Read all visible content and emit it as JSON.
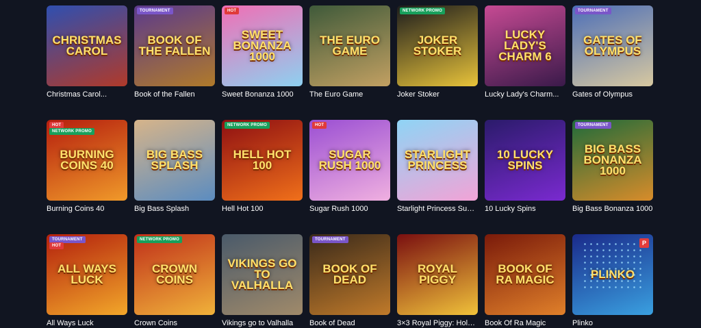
{
  "games": [
    {
      "name": "Christmas Carol...",
      "art_title": "Christmas Carol",
      "bg": [
        "#2f4fb0",
        "#b03a2a"
      ],
      "badges": []
    },
    {
      "name": "Book of the Fallen",
      "art_title": "Book of the Fallen",
      "bg": [
        "#5b3a8c",
        "#b07a2a"
      ],
      "badges": [
        {
          "text": "TOURNAMENT",
          "type": "tournament"
        }
      ]
    },
    {
      "name": "Sweet Bonanza 1000",
      "art_title": "Sweet Bonanza 1000",
      "bg": [
        "#f06fb5",
        "#8ed0f0"
      ],
      "badges": [
        {
          "text": "HOT",
          "type": "hot"
        }
      ]
    },
    {
      "name": "The Euro Game",
      "art_title": "The Euro Game",
      "bg": [
        "#3f5a3a",
        "#c2a062"
      ],
      "badges": []
    },
    {
      "name": "Joker Stoker",
      "art_title": "Joker Stoker",
      "bg": [
        "#1d1d1d",
        "#e8c33a"
      ],
      "badges": [
        {
          "text": "NETWORK PROMO",
          "type": "network"
        }
      ]
    },
    {
      "name": "Lucky Lady's Charm...",
      "art_title": "Lucky Lady's Charm 6",
      "bg": [
        "#c64a93",
        "#3a1a4a"
      ],
      "badges": []
    },
    {
      "name": "Gates of Olympus",
      "art_title": "Gates of Olympus",
      "bg": [
        "#4d6fb8",
        "#d7c8a0"
      ],
      "badges": [
        {
          "text": "TOURNAMENT",
          "type": "tournament"
        }
      ]
    },
    {
      "name": "Burning Coins 40",
      "art_title": "Burning Coins 40",
      "bg": [
        "#b51e0e",
        "#f09a2a"
      ],
      "badges": [
        {
          "text": "HOT",
          "type": "hot"
        },
        {
          "text": "NETWORK PROMO",
          "type": "network"
        }
      ]
    },
    {
      "name": "Big Bass Splash",
      "art_title": "Big Bass Splash",
      "bg": [
        "#d6b48a",
        "#5b8cc0"
      ],
      "badges": []
    },
    {
      "name": "Hell Hot 100",
      "art_title": "Hell Hot 100",
      "bg": [
        "#8e0f12",
        "#f0701a"
      ],
      "badges": [
        {
          "text": "NETWORK PROMO",
          "type": "network"
        }
      ]
    },
    {
      "name": "Sugar Rush 1000",
      "art_title": "Sugar Rush 1000",
      "bg": [
        "#9b4fd3",
        "#f0b0e0"
      ],
      "badges": [
        {
          "text": "HOT",
          "type": "hot"
        }
      ]
    },
    {
      "name": "Starlight Princess Supe...",
      "art_title": "Starlight Princess",
      "bg": [
        "#8fd4f5",
        "#f2a3d6"
      ],
      "badges": []
    },
    {
      "name": "10 Lucky Spins",
      "art_title": "10 Lucky Spins",
      "bg": [
        "#2b1b6b",
        "#7a2ad0"
      ],
      "badges": []
    },
    {
      "name": "Big Bass Bonanza 1000",
      "art_title": "Big Bass Bonanza 1000",
      "bg": [
        "#1f6b3a",
        "#d88c2a"
      ],
      "badges": [
        {
          "text": "TOURNAMENT",
          "type": "tournament"
        }
      ]
    },
    {
      "name": "All Ways Luck",
      "art_title": "All Ways Luck",
      "bg": [
        "#b3200d",
        "#f2a72a"
      ],
      "badges": [
        {
          "text": "TOURNAMENT",
          "type": "tournament"
        },
        {
          "text": "HOT",
          "type": "hot"
        }
      ]
    },
    {
      "name": "Crown Coins",
      "art_title": "Crown Coins",
      "bg": [
        "#c0301a",
        "#f0b23a"
      ],
      "badges": [
        {
          "text": "NETWORK PROMO",
          "type": "network"
        }
      ]
    },
    {
      "name": "Vikings go to Valhalla",
      "art_title": "Vikings go to Valhalla",
      "bg": [
        "#4a5a6a",
        "#a08a6a"
      ],
      "badges": []
    },
    {
      "name": "Book of Dead",
      "art_title": "Book of Dead",
      "bg": [
        "#3a2a1a",
        "#c07a2a"
      ],
      "badges": [
        {
          "text": "TOURNAMENT",
          "type": "tournament"
        }
      ]
    },
    {
      "name": "3×3 Royal Piggy: Hold...",
      "art_title": "Royal Piggy",
      "bg": [
        "#7a0f10",
        "#f0c23a"
      ],
      "badges": []
    },
    {
      "name": "Book Of Ra Magic",
      "art_title": "Book of Ra Magic",
      "bg": [
        "#7a1a0a",
        "#e0802a"
      ],
      "badges": []
    },
    {
      "name": "Plinko",
      "art_title": "Plinko",
      "bg": [
        "#1a2a8a",
        "#3aa0e0"
      ],
      "badges": [],
      "corner": "P",
      "dots": true
    }
  ]
}
